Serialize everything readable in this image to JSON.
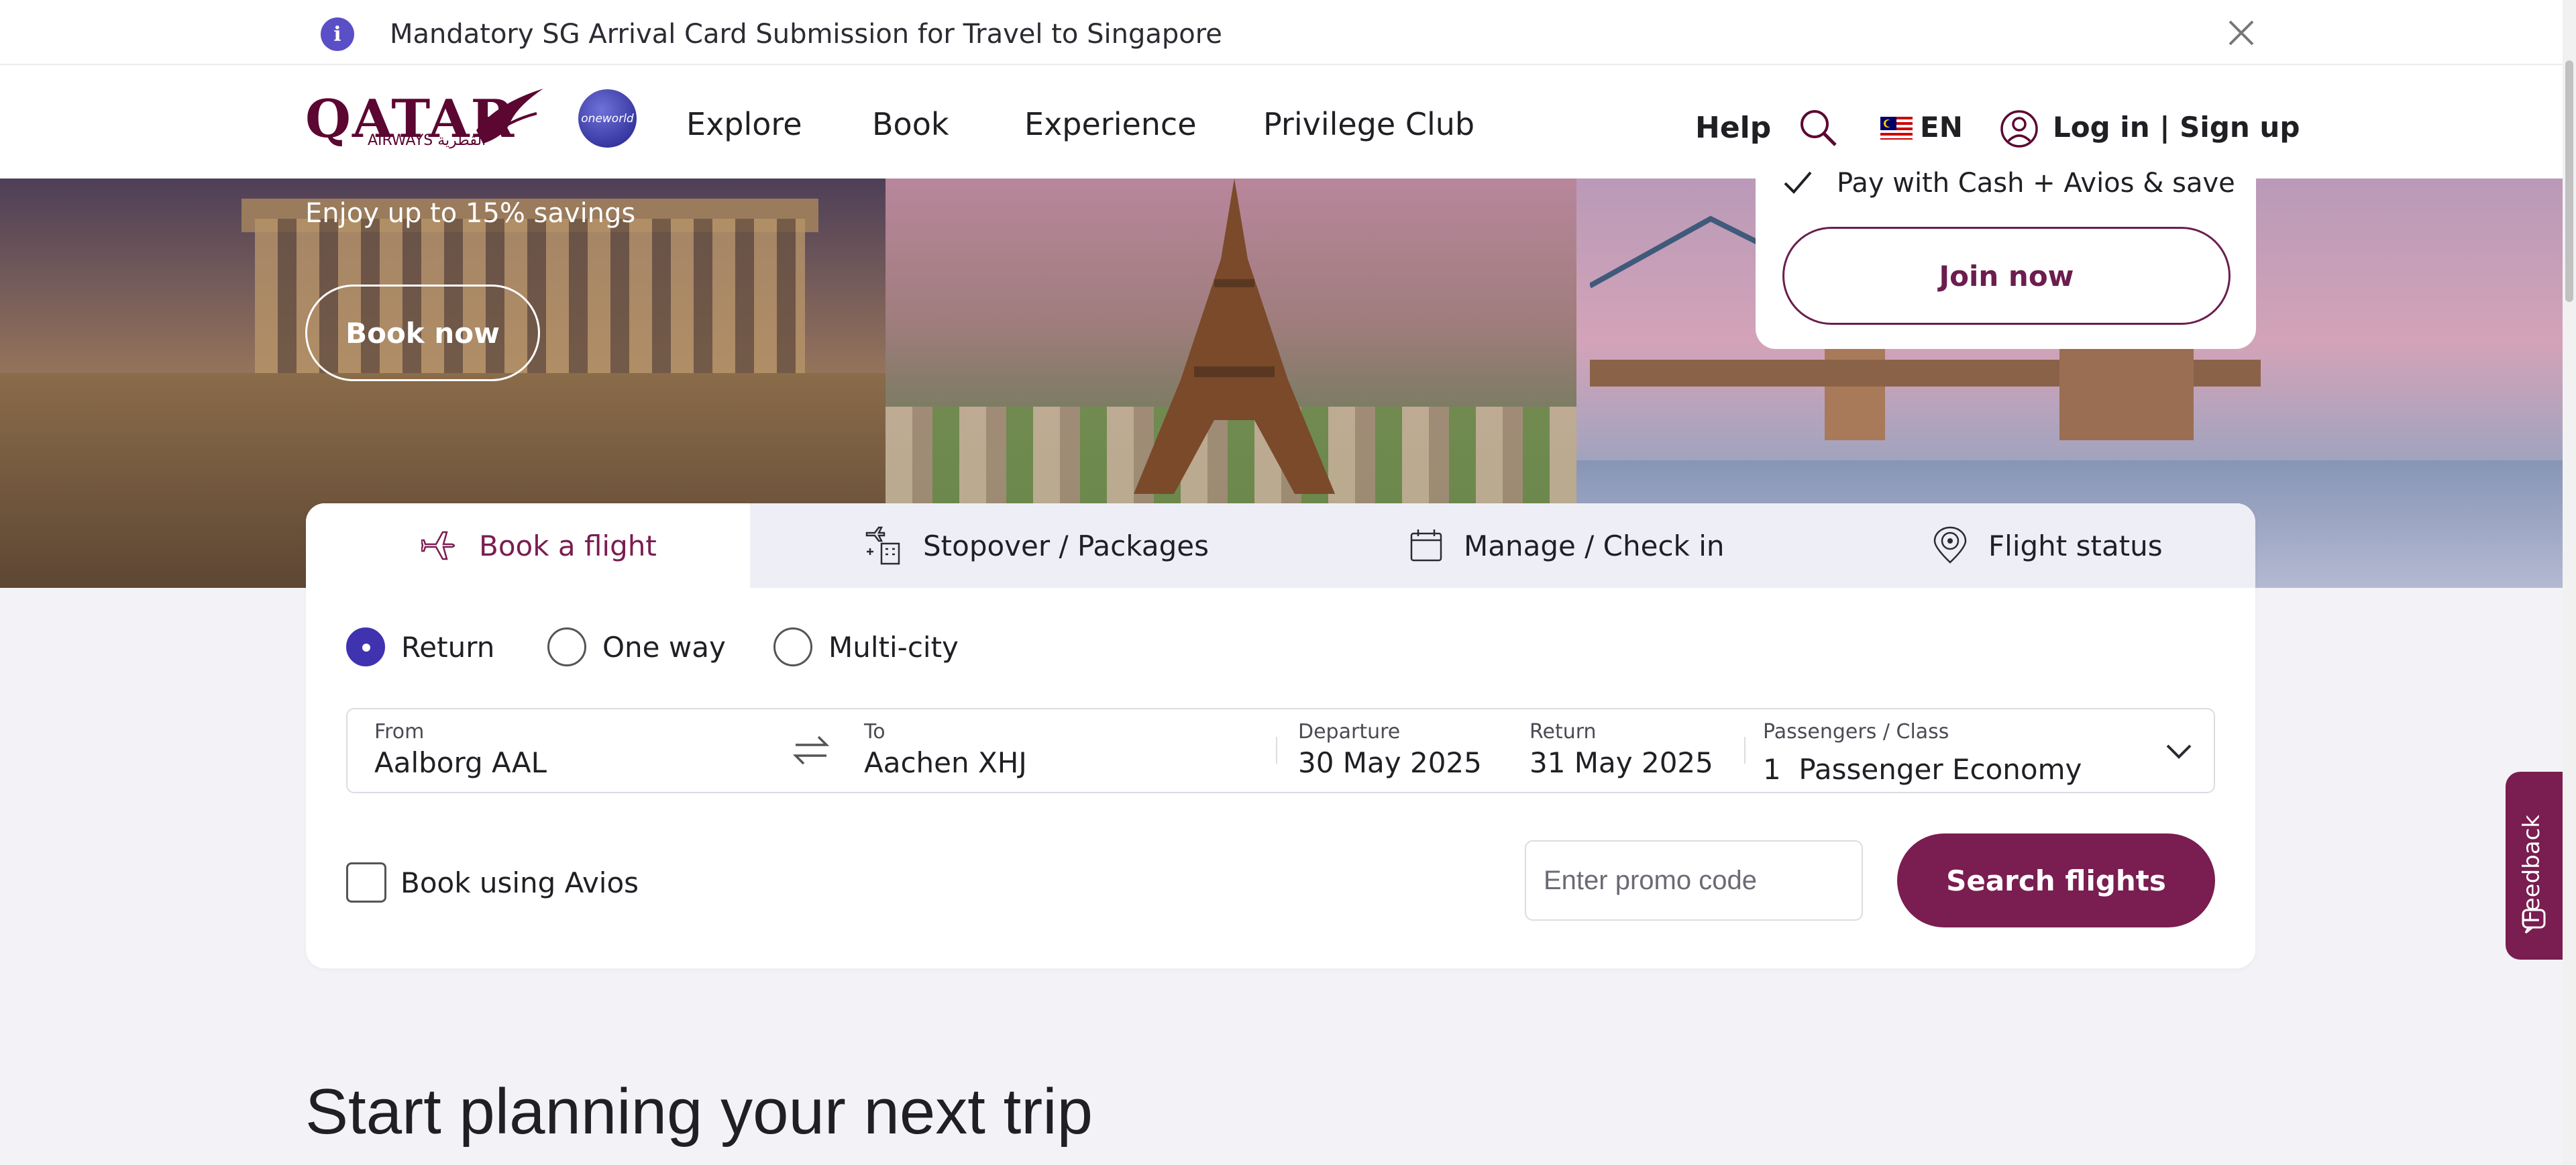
{
  "notice": {
    "text": "Mandatory SG Arrival Card Submission for Travel to Singapore"
  },
  "header": {
    "logo_text": "QATAR",
    "logo_sub": "AIRWAYS القطرية",
    "oneworld": "oneworld",
    "nav": [
      "Explore",
      "Book",
      "Experience",
      "Privilege Club"
    ],
    "help": "Help",
    "language": "EN",
    "login": "Log in | Sign up"
  },
  "hero": {
    "savings_text": "Enjoy up to 15% savings",
    "book_now": "Book now",
    "promo_text": "Pay with Cash + Avios & save",
    "join_now": "Join now"
  },
  "booking": {
    "tabs": [
      "Book a flight",
      "Stopover / Packages",
      "Manage / Check in",
      "Flight status"
    ],
    "trip_types": [
      "Return",
      "One way",
      "Multi-city"
    ],
    "selected_trip_type": "Return",
    "from_label": "From",
    "from_value": "Aalborg AAL",
    "to_label": "To",
    "to_value": "Aachen XHJ",
    "departure_label": "Departure",
    "departure_value": "30 May 2025",
    "return_label": "Return",
    "return_value": "31 May 2025",
    "passengers_label": "Passengers / Class",
    "passengers_value": "1  Passenger Economy",
    "avios_label": "Book using Avios",
    "promo_placeholder": "Enter promo code",
    "search_button": "Search flights"
  },
  "section_title": "Start planning your next trip",
  "feedback": "Feedback",
  "colors": {
    "brand": "#7a1d50",
    "accent": "#3f33b0",
    "notice_icon": "#5a4fc7"
  }
}
